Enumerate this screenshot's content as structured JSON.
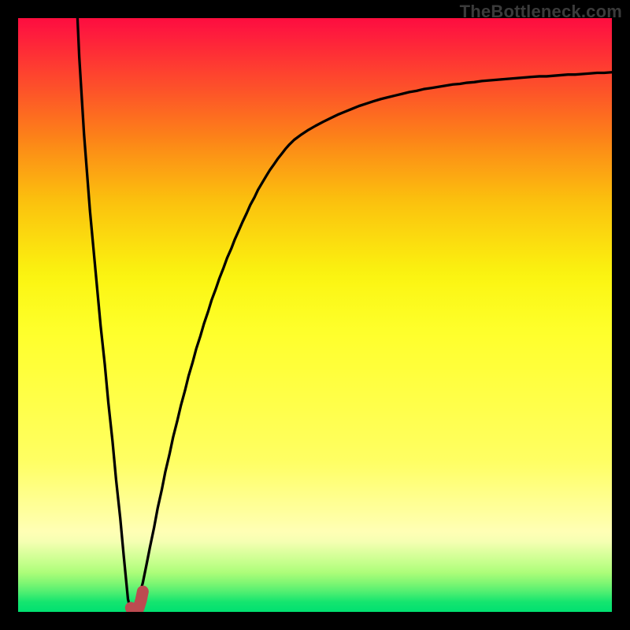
{
  "watermark": "TheBottleneck.com",
  "chart_data": {
    "type": "line",
    "title": "",
    "xlabel": "",
    "ylabel": "",
    "xlim": [
      0,
      100
    ],
    "ylim": [
      -2,
      100
    ],
    "series": [
      {
        "name": "curve",
        "color": "#000000",
        "x": [
          10.0,
          10.3,
          10.7,
          11.1,
          11.6,
          12.1,
          12.7,
          13.3,
          13.9,
          14.6,
          15.2,
          15.9,
          16.5,
          17.2,
          17.8,
          18.5,
          18.8,
          19.1,
          19.4,
          19.7,
          20.0,
          20.3,
          20.6,
          21.0,
          21.3,
          21.6,
          22.2,
          22.9,
          23.5,
          24.2,
          24.8,
          25.5,
          26.1,
          26.8,
          27.4,
          28.1,
          28.7,
          29.4,
          30.0,
          30.7,
          31.3,
          32.0,
          32.6,
          33.3,
          33.9,
          34.6,
          35.2,
          35.9,
          36.5,
          37.2,
          37.8,
          38.5,
          39.1,
          39.8,
          40.4,
          41.1,
          41.8,
          42.4,
          43.1,
          43.7,
          44.4,
          45.0,
          45.7,
          46.5,
          47.7,
          48.9,
          50.1,
          51.4,
          52.6,
          53.8,
          55.0,
          56.2,
          57.4,
          58.6,
          59.8,
          61.1,
          62.3,
          63.5,
          64.7,
          65.9,
          67.1,
          68.3,
          69.6,
          70.8,
          72.0,
          73.2,
          74.4,
          75.6,
          76.8,
          78.1,
          79.3,
          80.5,
          81.7,
          82.9,
          84.1,
          85.3,
          86.5,
          87.8,
          89.0,
          90.2,
          91.4,
          92.6,
          93.8,
          95.0,
          96.3,
          97.5,
          98.7,
          100.0
        ],
        "y": [
          100.0,
          93.3,
          86.7,
          80.1,
          73.5,
          66.9,
          60.3,
          53.7,
          47.1,
          40.5,
          33.9,
          27.3,
          20.7,
          14.1,
          7.5,
          0.2,
          -1.1,
          -1.9,
          -2.0,
          -1.9,
          -1.1,
          0.2,
          1.5,
          3.0,
          4.5,
          6.0,
          9.1,
          12.5,
          15.8,
          19.0,
          22.1,
          25.1,
          28.0,
          30.8,
          33.4,
          36.0,
          38.5,
          40.9,
          43.2,
          45.4,
          47.5,
          49.6,
          51.6,
          53.5,
          55.3,
          57.1,
          58.8,
          60.4,
          62.0,
          63.6,
          65.0,
          66.5,
          67.9,
          69.2,
          70.5,
          71.7,
          72.9,
          73.9,
          74.9,
          75.8,
          76.7,
          77.5,
          78.3,
          79.1,
          80.0,
          80.8,
          81.5,
          82.2,
          82.8,
          83.4,
          83.9,
          84.4,
          84.9,
          85.3,
          85.7,
          86.1,
          86.4,
          86.7,
          87.0,
          87.3,
          87.5,
          87.8,
          88.0,
          88.2,
          88.4,
          88.6,
          88.7,
          88.9,
          89.0,
          89.2,
          89.3,
          89.4,
          89.5,
          89.6,
          89.7,
          89.8,
          89.9,
          90.0,
          90.0,
          90.1,
          90.2,
          90.3,
          90.3,
          90.4,
          90.5,
          90.6,
          90.6,
          90.7
        ]
      },
      {
        "name": "highlight",
        "color": "#bc4b51",
        "x": [
          19.0,
          19.3,
          19.7,
          20.0,
          20.3,
          20.7,
          21.0
        ],
        "y": [
          -1.3,
          -1.9,
          -2.0,
          -1.9,
          -1.3,
          0.0,
          1.5
        ]
      }
    ],
    "gradient_bands": [
      {
        "color": "#FD0D3E",
        "top_pct": 0.0
      },
      {
        "color": "#FD123F",
        "top_pct": 1.0
      },
      {
        "color": "#FE1C3D",
        "top_pct": 2.7
      },
      {
        "color": "#FE2639",
        "top_pct": 4.4
      },
      {
        "color": "#FE3035",
        "top_pct": 6.1
      },
      {
        "color": "#FE3A32",
        "top_pct": 7.8
      },
      {
        "color": "#FE442E",
        "top_pct": 9.5
      },
      {
        "color": "#FD4E2B",
        "top_pct": 11.3
      },
      {
        "color": "#FD5827",
        "top_pct": 13.0
      },
      {
        "color": "#FD6224",
        "top_pct": 14.7
      },
      {
        "color": "#FD6C20",
        "top_pct": 16.4
      },
      {
        "color": "#FD761D",
        "top_pct": 18.1
      },
      {
        "color": "#FC8019",
        "top_pct": 19.8
      },
      {
        "color": "#FC8B17",
        "top_pct": 21.5
      },
      {
        "color": "#FC9515",
        "top_pct": 23.2
      },
      {
        "color": "#FC9F14",
        "top_pct": 24.9
      },
      {
        "color": "#FCA912",
        "top_pct": 26.7
      },
      {
        "color": "#FCB310",
        "top_pct": 28.4
      },
      {
        "color": "#FBBD0E",
        "top_pct": 30.1
      },
      {
        "color": "#FBC50E",
        "top_pct": 31.8
      },
      {
        "color": "#FBCC0E",
        "top_pct": 33.5
      },
      {
        "color": "#FBD30F",
        "top_pct": 35.2
      },
      {
        "color": "#FBDA0F",
        "top_pct": 36.9
      },
      {
        "color": "#FBE10F",
        "top_pct": 38.6
      },
      {
        "color": "#FBE80F",
        "top_pct": 40.3
      },
      {
        "color": "#FAEF10",
        "top_pct": 42.0
      },
      {
        "color": "#FBF412",
        "top_pct": 43.8
      },
      {
        "color": "#FCF717",
        "top_pct": 45.5
      },
      {
        "color": "#FCF91C",
        "top_pct": 47.2
      },
      {
        "color": "#FDFB20",
        "top_pct": 48.9
      },
      {
        "color": "#FDFD25",
        "top_pct": 50.6
      },
      {
        "color": "#FEFF2A",
        "top_pct": 52.3
      },
      {
        "color": "#FFFF2E",
        "top_pct": 54.0
      },
      {
        "color": "#FFFF33",
        "top_pct": 55.7
      },
      {
        "color": "#FFFF37",
        "top_pct": 57.4
      },
      {
        "color": "#FFFF3B",
        "top_pct": 59.2
      },
      {
        "color": "#FFFF40",
        "top_pct": 60.9
      },
      {
        "color": "#FFFF44",
        "top_pct": 62.6
      },
      {
        "color": "#FFFF48",
        "top_pct": 64.3
      },
      {
        "color": "#FFFF4C",
        "top_pct": 66.0
      },
      {
        "color": "#FFFF51",
        "top_pct": 67.7
      },
      {
        "color": "#FFFF55",
        "top_pct": 69.4
      },
      {
        "color": "#FFFF59",
        "top_pct": 71.1
      },
      {
        "color": "#FFFF5E",
        "top_pct": 72.8
      },
      {
        "color": "#FFFF63",
        "top_pct": 74.5
      },
      {
        "color": "#FFFF6E",
        "top_pct": 76.3
      },
      {
        "color": "#FFFF7A",
        "top_pct": 78.0
      },
      {
        "color": "#FFFF86",
        "top_pct": 79.7
      },
      {
        "color": "#FFFF92",
        "top_pct": 81.4
      },
      {
        "color": "#FFFF9D",
        "top_pct": 83.1
      },
      {
        "color": "#FFFFA9",
        "top_pct": 84.8
      },
      {
        "color": "#FFFFB5",
        "top_pct": 86.5
      },
      {
        "color": "#F5FFB2",
        "top_pct": 88.2
      },
      {
        "color": "#DDFF9F",
        "top_pct": 89.9
      },
      {
        "color": "#C5FF8C",
        "top_pct": 91.7
      },
      {
        "color": "#ACFD79",
        "top_pct": 93.4
      },
      {
        "color": "#80F673",
        "top_pct": 95.1
      },
      {
        "color": "#4BEE71",
        "top_pct": 96.8
      },
      {
        "color": "#15E56F",
        "top_pct": 98.3
      },
      {
        "color": "#00E070",
        "top_pct": 100.0
      }
    ]
  }
}
